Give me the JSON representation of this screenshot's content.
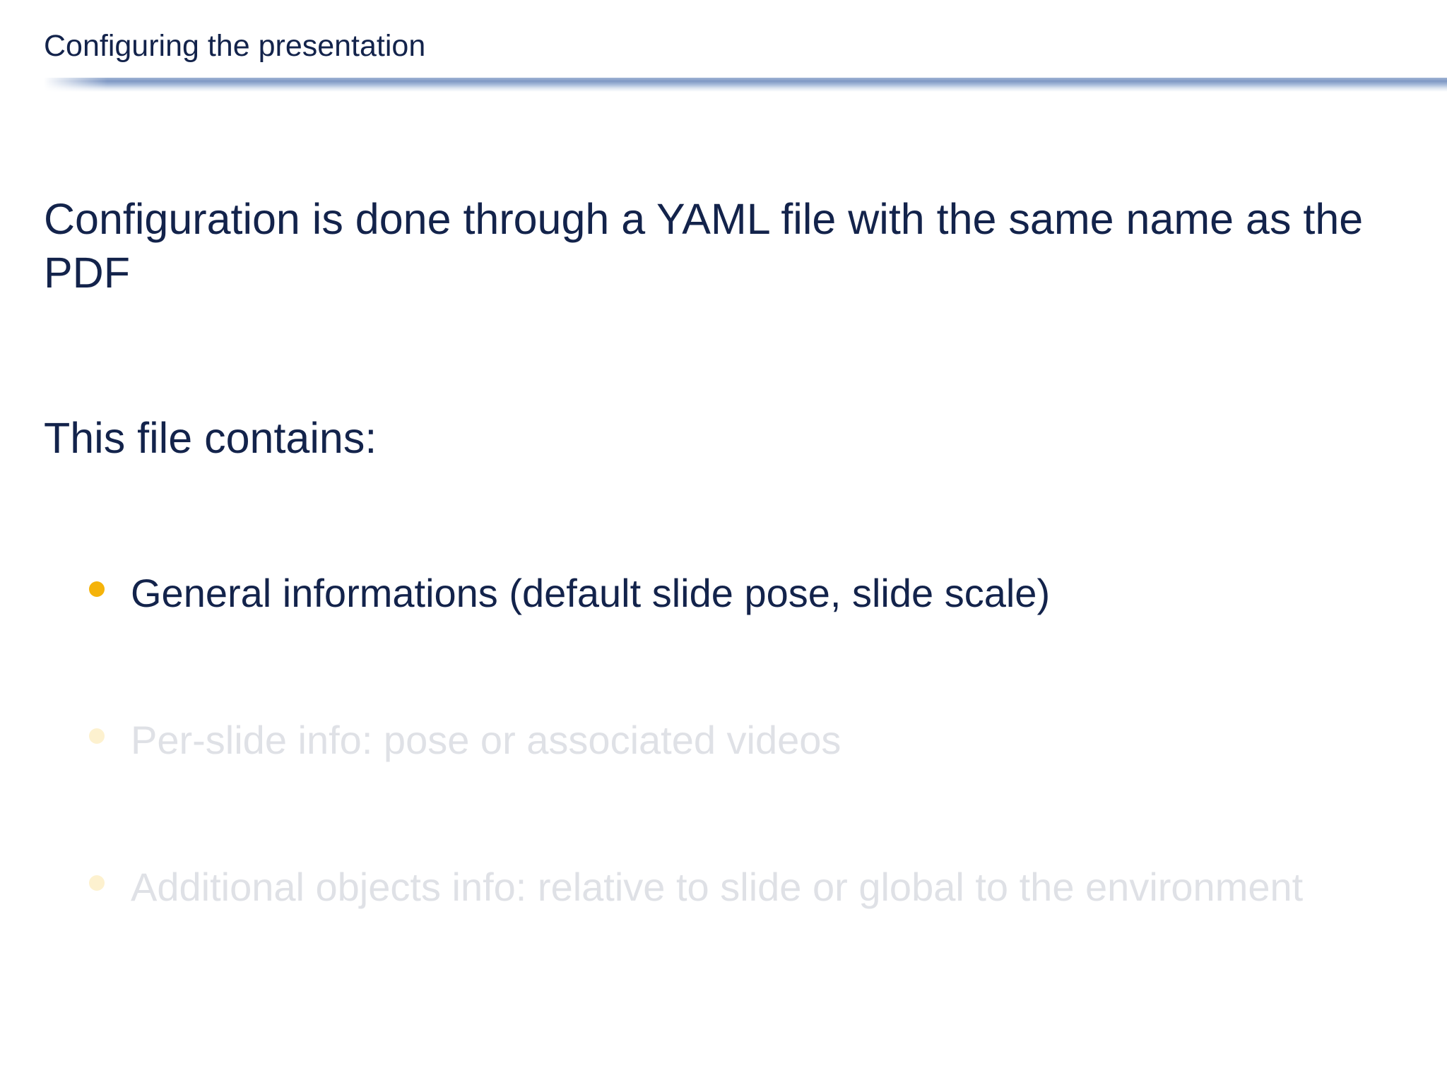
{
  "slide": {
    "frame_title": "Configuring the presentation",
    "intro_text": "Configuration is done through a YAML file with the same name as the PDF",
    "contains_label": "This file contains:",
    "bullets": [
      {
        "text": "General informations (default slide pose, slide scale)",
        "state": "active",
        "text_color": "#13234b",
        "bullet_color": "#f5b30a"
      },
      {
        "text": "Per-slide info: pose or associated videos",
        "state": "dimmed",
        "text_color": "#dfe1e6",
        "bullet_color": "#fdf1cf"
      },
      {
        "text": "Additional objects info: relative to slide or global to the environment",
        "state": "dimmed",
        "text_color": "#dfe1e6",
        "bullet_color": "#fdf1cf"
      }
    ]
  },
  "colors": {
    "text_dark": "#13234b",
    "accent_bullet": "#f5b30a",
    "title_rule": "#7f98c4",
    "background": "#ffffff"
  }
}
